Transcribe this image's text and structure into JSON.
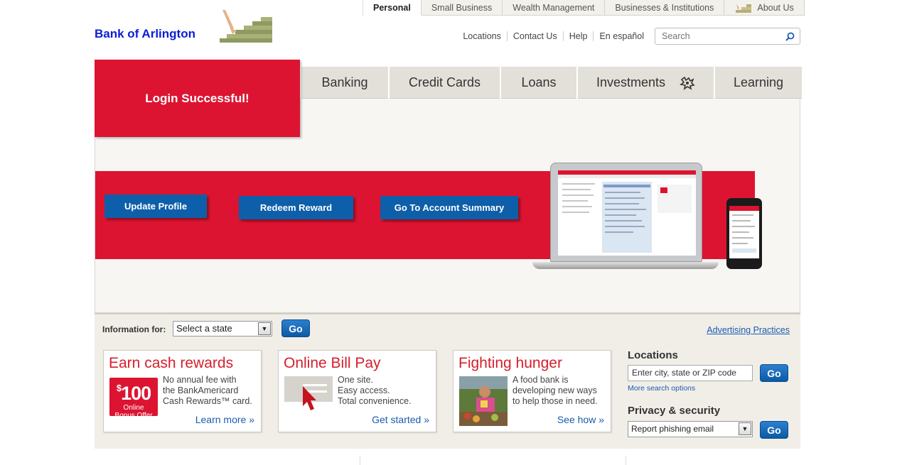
{
  "top_tabs": [
    {
      "label": "Personal",
      "active": true
    },
    {
      "label": "Small Business",
      "active": false
    },
    {
      "label": "Wealth Management",
      "active": false
    },
    {
      "label": "Businesses & Institutions",
      "active": false
    },
    {
      "label": "About Us",
      "active": false
    }
  ],
  "logo": {
    "text": "Bank of Arlington"
  },
  "utility_links": [
    "Locations",
    "Contact Us",
    "Help",
    "En español"
  ],
  "search": {
    "placeholder": "Search"
  },
  "nav": [
    "Banking",
    "Credit Cards",
    "Loans",
    "Investments",
    "Learning"
  ],
  "login_banner": "Login Successful!",
  "hero_buttons": [
    "Update Profile",
    "Redeem Reward",
    "Go To Account Summary"
  ],
  "info_bar": {
    "label": "Information for:",
    "state_select": "Select a state",
    "go": "Go",
    "advertising": "Advertising Practices"
  },
  "cards": [
    {
      "title": "Earn cash rewards",
      "badge_amount": "100",
      "badge_currency": "$",
      "badge_line1": "Online",
      "badge_line2": "Bonus Offer",
      "lines": [
        "No annual fee with",
        "the BankAmericard",
        "Cash Rewards™ card."
      ],
      "link": "Learn more »"
    },
    {
      "title": "Online Bill Pay",
      "lines": [
        "One site.",
        "Easy access.",
        "Total convenience."
      ],
      "link": "Get started »"
    },
    {
      "title": "Fighting hunger",
      "lines": [
        "A food bank is",
        "developing new ways",
        "to help those in need."
      ],
      "link": "See how »"
    }
  ],
  "locations": {
    "heading": "Locations",
    "input_placeholder": "Enter city, state or ZIP code",
    "go": "Go",
    "more": "More search options"
  },
  "privacy": {
    "heading": "Privacy & security",
    "select": "Report phishing email",
    "go": "Go"
  },
  "colors": {
    "brand_red": "#dc1431",
    "button_blue": "#0e5fa9",
    "logo_blue": "#0a1dd8"
  }
}
